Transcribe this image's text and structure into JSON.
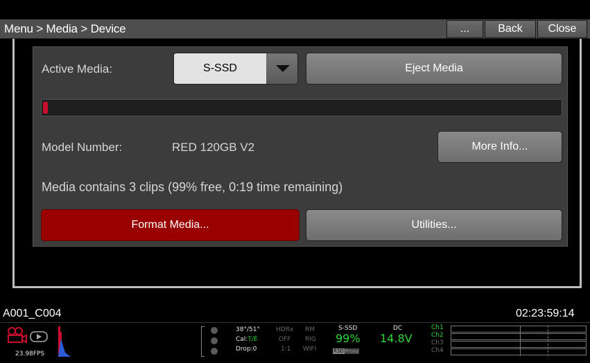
{
  "header": {
    "breadcrumb": "Menu > Media > Device",
    "more_label": "...",
    "back_label": "Back",
    "close_label": "Close"
  },
  "panel": {
    "active_media_label": "Active Media:",
    "active_media_value": "S-SSD",
    "eject_label": "Eject Media",
    "usage_fraction": 0.01,
    "model_label": "Model Number:",
    "model_value": "RED 120GB V2",
    "more_info_label": "More Info...",
    "media_status": "Media contains 3 clips (99% free, 0:19 time remaining)",
    "format_label": "Format Media...",
    "utilities_label": "Utilities..."
  },
  "info": {
    "clip_name": "A001_C004",
    "timecode": "02:23:59:14"
  },
  "status_bar": {
    "fps": "23.98FPS",
    "temp": "38°/51°",
    "cal_prefix": "Cal:",
    "cal_value": "T/E",
    "drop": "Drop:0",
    "hdrx": "HDRx",
    "hdrx_value": "OFF",
    "ratio": "1:1",
    "rm": "RM",
    "rig": "RIG",
    "wifi": "WIFI",
    "media_name": "S-SSD",
    "media_percent": "99%",
    "r3d_tag": "R3D",
    "proxy_tag": "Proxy",
    "power_label": "DC",
    "power_value": "14.8V",
    "channels": [
      "Ch1",
      "Ch2",
      "Ch3",
      "Ch4"
    ]
  },
  "colors": {
    "accent_red": "#c8102e",
    "format_red": "#990000",
    "status_green": "#2fd63a"
  }
}
